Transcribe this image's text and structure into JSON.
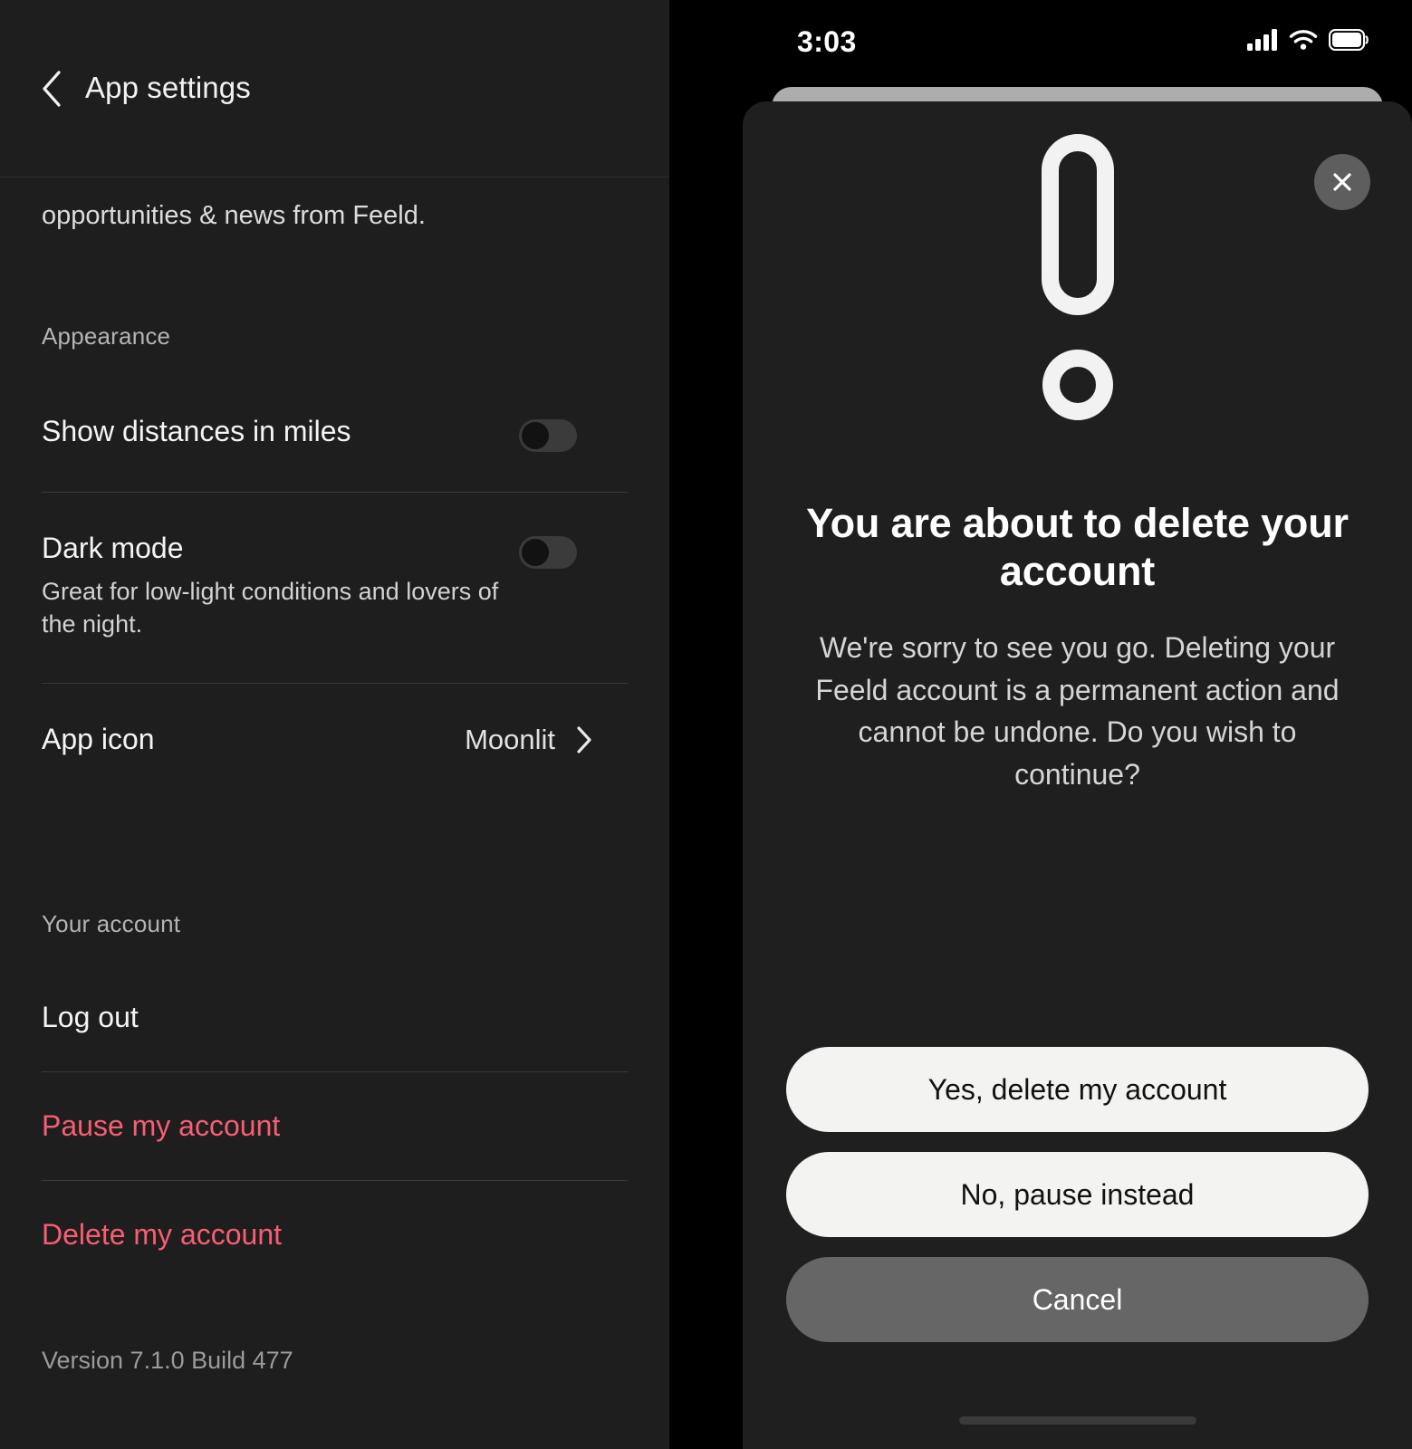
{
  "left": {
    "nav": {
      "back_icon": "chevron-left-icon",
      "title": "App settings"
    },
    "scrolled_text": "opportunities & news from Feeld.",
    "appearance": {
      "label": "Appearance",
      "rows": [
        {
          "title": "Show distances in miles",
          "subtitle": "",
          "toggle": "off"
        },
        {
          "title": "Dark mode",
          "subtitle": "Great for low-light conditions and lovers of the night.",
          "toggle": "off"
        }
      ],
      "app_icon": {
        "title": "App icon",
        "value": "Moonlit",
        "chevron_icon": "chevron-right-icon"
      }
    },
    "account": {
      "label": "Your account",
      "log_out": "Log out",
      "pause": "Pause my account",
      "delete": "Delete my account",
      "danger_color": "#f85d73"
    },
    "version": "Version 7.1.0 Build 477"
  },
  "right": {
    "status_bar": {
      "time": "3:03",
      "cellular_icon": "cellular-signal-icon",
      "wifi_icon": "wifi-icon",
      "battery_icon": "battery-full-icon"
    },
    "modal": {
      "close_icon": "close-icon",
      "alert_icon": "exclamation-mark-icon",
      "title": "You are about to delete your account",
      "body": "We're sorry to see you go. Deleting your Feeld account is a permanent action and cannot be undone. Do you wish to continue?",
      "buttons": {
        "confirm": "Yes, delete my account",
        "pause": "No, pause instead",
        "cancel": "Cancel"
      }
    },
    "home_indicator": "home-indicator"
  }
}
